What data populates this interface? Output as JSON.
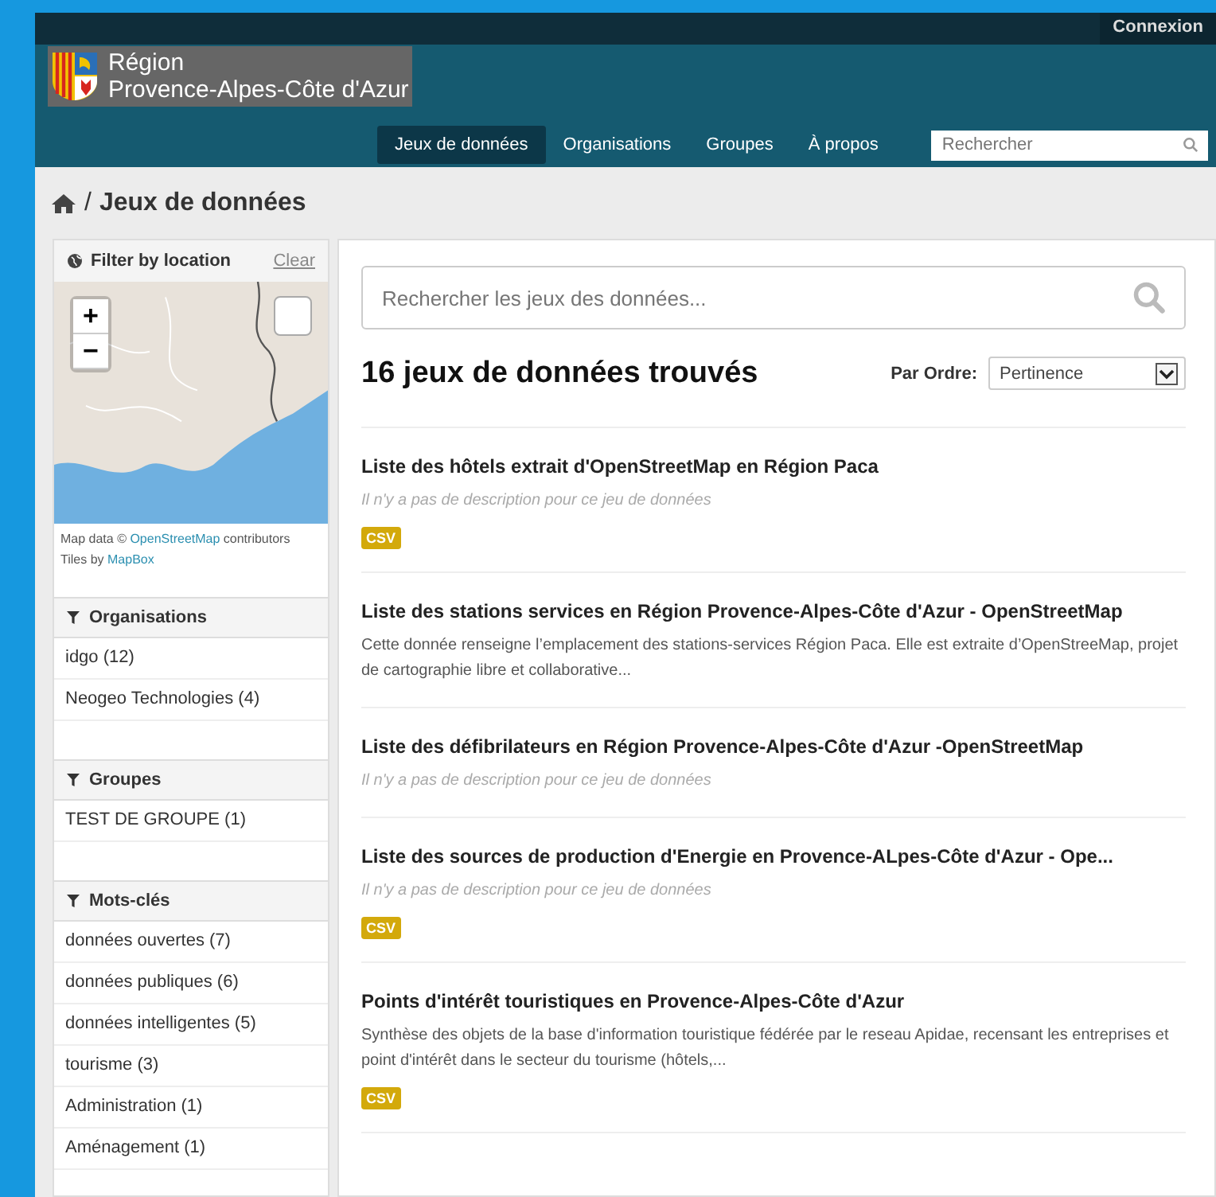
{
  "topbar": {
    "login": "Connexion"
  },
  "brand": {
    "line1": "Région",
    "line2": "Provence-Alpes-Côte d'Azur"
  },
  "nav": [
    {
      "label": "Jeux de données",
      "selected": true
    },
    {
      "label": "Organisations",
      "selected": false
    },
    {
      "label": "Groupes",
      "selected": false
    },
    {
      "label": "À propos",
      "selected": false
    }
  ],
  "site_search": {
    "placeholder": "Rechercher"
  },
  "breadcrumb": {
    "separator": "/",
    "current": "Jeux de données"
  },
  "location_filter": {
    "title": "Filter by location",
    "clear": "Clear",
    "zoom_in": "+",
    "zoom_out": "−",
    "attribution": [
      {
        "text": "Map data © ",
        "link": "OpenStreetMap",
        "after": " contributors"
      },
      {
        "text": "Tiles by ",
        "link": "MapBox"
      }
    ]
  },
  "facets": [
    {
      "title": "Organisations",
      "items": [
        "idgo (12)",
        "Neogeo Technologies (4)"
      ]
    },
    {
      "title": "Groupes",
      "items": [
        "TEST DE GROUPE (1)"
      ]
    },
    {
      "title": "Mots-clés",
      "items": [
        "données ouvertes (7)",
        "données publiques (6)",
        "données intelligentes (5)",
        "tourisme (3)",
        "Administration (1)",
        "Aménagement (1)"
      ]
    }
  ],
  "dataset_search": {
    "placeholder": "Rechercher les jeux des données..."
  },
  "results": {
    "count": "16 jeux de données trouvés",
    "sort_label": "Par Ordre:",
    "sort_value": "Pertinence"
  },
  "datasets": [
    {
      "title": "Liste des hôtels extrait d'OpenStreetMap en Région Paca",
      "description": "Il n'y a pas de description pour ce jeu de données",
      "kind": "empty",
      "formats": [
        "CSV"
      ]
    },
    {
      "title": "Liste des stations services en Région Provence-Alpes-Côte d'Azur - OpenStreetMap",
      "description": "Cette donnée renseigne l’emplacement des stations-services Région Paca. Elle est extraite d’OpenStreeMap, projet de cartographie libre et collaborative...",
      "kind": "text"
    },
    {
      "title": "Liste des défibrilateurs en Région Provence-Alpes-Côte d'Azur -OpenStreetMap",
      "description": "Il n'y a pas de description pour ce jeu de données",
      "kind": "empty"
    },
    {
      "title": "Liste des sources de production d'Energie en Provence-ALpes-Côte d'Azur - Ope...",
      "description": "Il n'y a pas de description pour ce jeu de données",
      "kind": "empty",
      "formats": [
        "CSV"
      ]
    },
    {
      "title": "Points d'intérêt touristiques en Provence-Alpes-Côte d'Azur",
      "description": "Synthèse des objets de la base d'information touristique fédérée par le reseau Apidae, recensant les entreprises et point d'intérêt dans le secteur du tourisme (hôtels,...",
      "kind": "text",
      "formats": [
        "CSV"
      ]
    }
  ]
}
